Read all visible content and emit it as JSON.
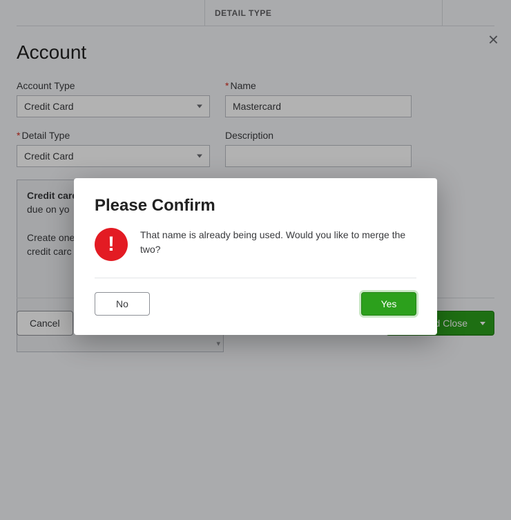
{
  "header": {
    "tab_label": "DETAIL TYPE"
  },
  "page_title": "Account",
  "form": {
    "account_type": {
      "label": "Account Type",
      "value": "Credit Card"
    },
    "detail_type": {
      "label": "Detail Type",
      "value": "Credit Card"
    },
    "name": {
      "label": "Name",
      "value": "Mastercard"
    },
    "description": {
      "label": "Description",
      "value": ""
    }
  },
  "info_box": {
    "bold": "Credit card",
    "line1": " accounts track the balance due on yo",
    "line2": "Create one Credit card account for each credit carc"
  },
  "footer": {
    "cancel": "Cancel",
    "save": "Save and Close"
  },
  "modal": {
    "title": "Please Confirm",
    "message": "That name is already being used. Would you like to merge the two?",
    "no": "No",
    "yes": "Yes"
  }
}
